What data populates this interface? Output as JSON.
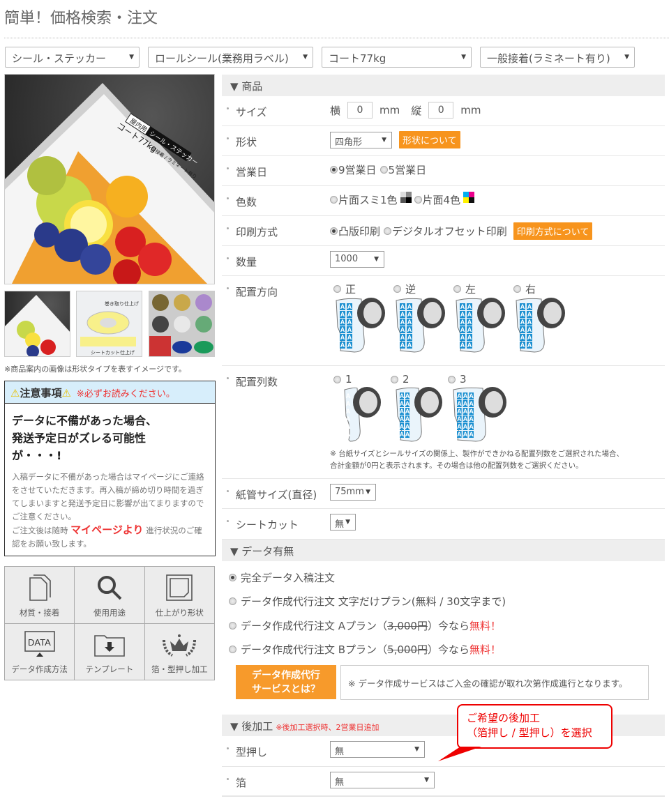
{
  "title": "簡単！価格検索・注文",
  "filters": [
    "シール・ステッカー",
    "ロールシール(業務用ラベル)",
    "コート77kg",
    "一般接着(ラミネート有り)"
  ],
  "caption": "※商品案内の画像は形状タイプを表すイメージです。",
  "images": {
    "main_text": [
      "屋内用",
      "シール・ステッカー",
      "コート77kg",
      "一般接着 / ラミネート有り"
    ],
    "thumb2_text": [
      "巻き取り仕上げ",
      "シートカット仕上げ"
    ]
  },
  "notice": {
    "title": "注意事項",
    "must_read": "※必ずお読みください。",
    "headline": [
      "データに不備があった場合、",
      "発送予定日がズレる可能性",
      "が・・・!"
    ],
    "body1": "入稿データに不備があった場合はマイページにご連絡をさせていただきます。再入稿が締め切り時間を過ぎてしまいますと発送予定日に影響が出てまりますのでご注意ください。",
    "body2_pre": "ご注文後は随時",
    "body2_link": "マイページより",
    "body2_post": "進行状況のご確認をお願い致します。"
  },
  "nav_grid": [
    {
      "label": "材質・接着",
      "icon": "documents-icon"
    },
    {
      "label": "使用用途",
      "icon": "search-icon"
    },
    {
      "label": "仕上がり形状",
      "icon": "sticker-icon"
    },
    {
      "label": "データ作成方法",
      "icon": "data-monitor-icon"
    },
    {
      "label": "テンプレート",
      "icon": "folder-download-icon"
    },
    {
      "label": "箔・型押し加工",
      "icon": "crown-laurel-icon"
    }
  ],
  "product": {
    "header": "▼ 商品",
    "size": {
      "label": "サイズ",
      "w_label": "横",
      "w": "0",
      "h_label": "縦",
      "h": "0",
      "unit": "mm"
    },
    "shape": {
      "label": "形状",
      "value": "四角形",
      "button": "形状について"
    },
    "days": {
      "label": "営業日",
      "options": [
        "9営業日",
        "5営業日"
      ],
      "selected": 0
    },
    "colors": {
      "label": "色数",
      "options": [
        "片面スミ1色",
        "片面4色"
      ]
    },
    "print": {
      "label": "印刷方式",
      "options": [
        "凸版印刷",
        "デジタルオフセット印刷"
      ],
      "selected": 0,
      "button": "印刷方式について"
    },
    "qty": {
      "label": "数量",
      "value": "1000"
    },
    "orientation": {
      "label": "配置方向",
      "options": [
        "正",
        "逆",
        "左",
        "右"
      ]
    },
    "columns": {
      "label": "配置列数",
      "options": [
        "1",
        "2",
        "3"
      ],
      "note1": "※ 台紙サイズとシールサイズの関係上、製作ができかねる配置列数をご選択された場合、",
      "note2": "合計金額が0円と表示されます。その場合は他の配置列数をご選択ください。"
    },
    "core": {
      "label": "紙管サイズ(直径)",
      "value": "75mm"
    },
    "sheetcut": {
      "label": "シートカット",
      "value": "無"
    }
  },
  "data_section": {
    "header": "▼ データ有無",
    "opt0": "完全データ入稿注文",
    "opt1": "データ作成代行注文 文字だけプラン(無料 / 30文字まで)",
    "opt2": {
      "pre": "データ作成代行注文 Aプラン（",
      "price": "3,000円",
      "mid": "）今なら",
      "free": "無料！"
    },
    "opt3": {
      "pre": "データ作成代行注文 Bプラン（",
      "price": "5,000円",
      "mid": "）今なら",
      "free": "無料！"
    },
    "button": [
      "データ作成代行",
      "サービスとは？"
    ],
    "note": "※ データ作成サービスはご入金の確認が取れ次第作成進行となります。"
  },
  "post": {
    "header": "▼ 後加工",
    "note": "※後加工選択時、2営業日追加",
    "emboss": {
      "label": "型押し",
      "value": "無"
    },
    "foil": {
      "label": "箔",
      "value": "無"
    }
  },
  "callout": [
    "ご希望の後加工",
    "（箔押し / 型押し）を選択"
  ],
  "colors": {
    "accent": "#f7941d",
    "red": "#ee3333",
    "notice_bg": "#d7eefb",
    "roll_blue": "#1a8fd0"
  }
}
